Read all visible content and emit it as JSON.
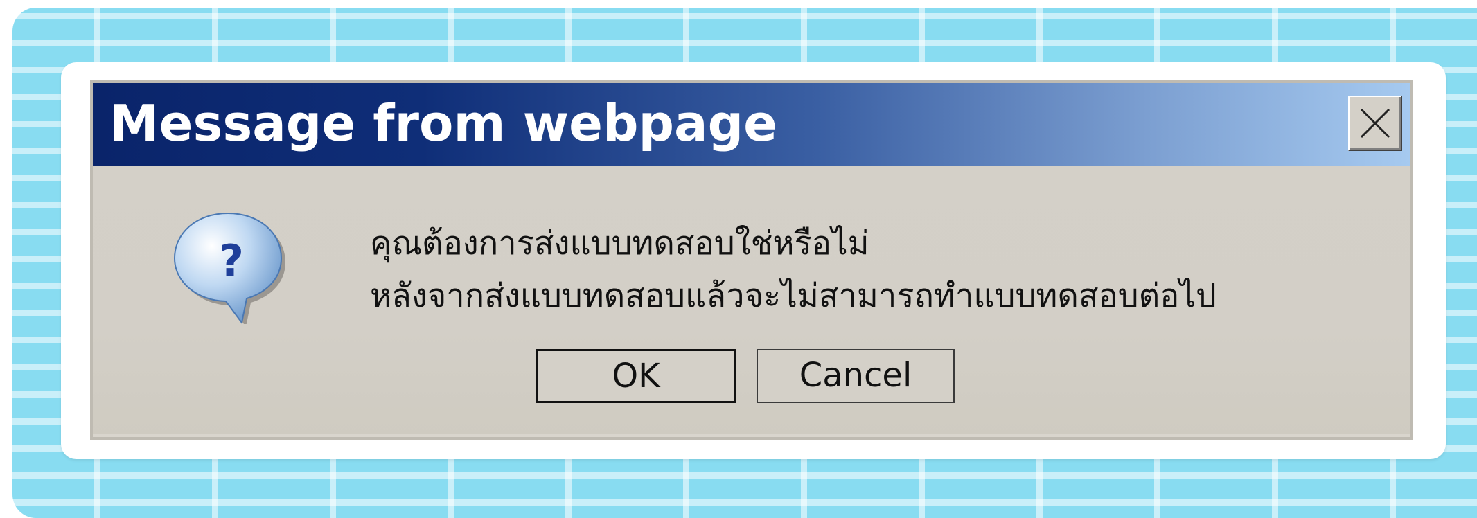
{
  "dialog": {
    "title": "Message from webpage",
    "close_icon": "close-icon",
    "question_icon": "question-balloon-icon",
    "message_lines": [
      "คุณต้องการส่งแบบทดสอบใช่หรือไม่",
      "หลังจากส่งแบบทดสอบแล้วจะไม่สามารถทำแบบทดสอบต่อไป"
    ],
    "ok_label": "OK",
    "cancel_label": "Cancel"
  },
  "colors": {
    "titlebar_start": "#0a246a",
    "titlebar_end": "#a6caf0",
    "dialog_face": "#d4d0c8",
    "background_tiles": "#88dcf1"
  }
}
